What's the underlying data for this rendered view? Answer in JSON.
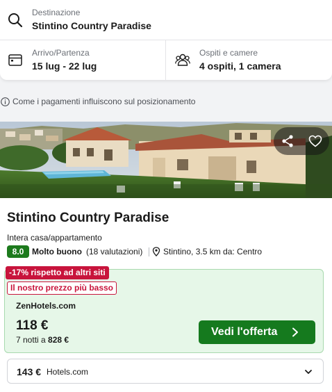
{
  "search": {
    "destination_label": "Destinazione",
    "destination_value": "Stintino Country Paradise",
    "dates_label": "Arrivo/Partenza",
    "dates_value": "15 lug - 22 lug",
    "guests_label": "Ospiti e camere",
    "guests_value": "4 ospiti, 1 camera"
  },
  "info": {
    "ranking_note": "Come i pagamenti influiscono sul posizionamento"
  },
  "hotel": {
    "name": "Stintino Country Paradise",
    "type": "Intera casa/appartamento",
    "score": "8.0",
    "score_label": "Molto buono",
    "reviews": "(18 valutazioni)",
    "location": "Stintino, 3.5 km da: Centro"
  },
  "deal": {
    "discount_tag": "-17% rispetto ad altri siti",
    "lowest_tag": "Il nostro prezzo più basso",
    "provider": "ZenHotels.com",
    "price": "118 €",
    "nights_text": "7 notti a",
    "total": "828 €",
    "cta_label": "Vedi l'offerta"
  },
  "alternative": {
    "price": "143 €",
    "provider": "Hotels.com"
  },
  "icons": {
    "search": "search-icon",
    "calendar": "calendar-icon",
    "guests": "guests-icon",
    "info": "info-icon",
    "share": "share-icon",
    "favorite": "heart-icon",
    "location": "location-pin-icon",
    "cta_arrow": "chevron-right-icon",
    "expand": "chevron-down-icon"
  },
  "colors": {
    "score_badge": "#1d7a1d",
    "discount_tag": "#c8143c",
    "deal_background": "#e6f7e8",
    "cta_button": "#157a1e"
  }
}
